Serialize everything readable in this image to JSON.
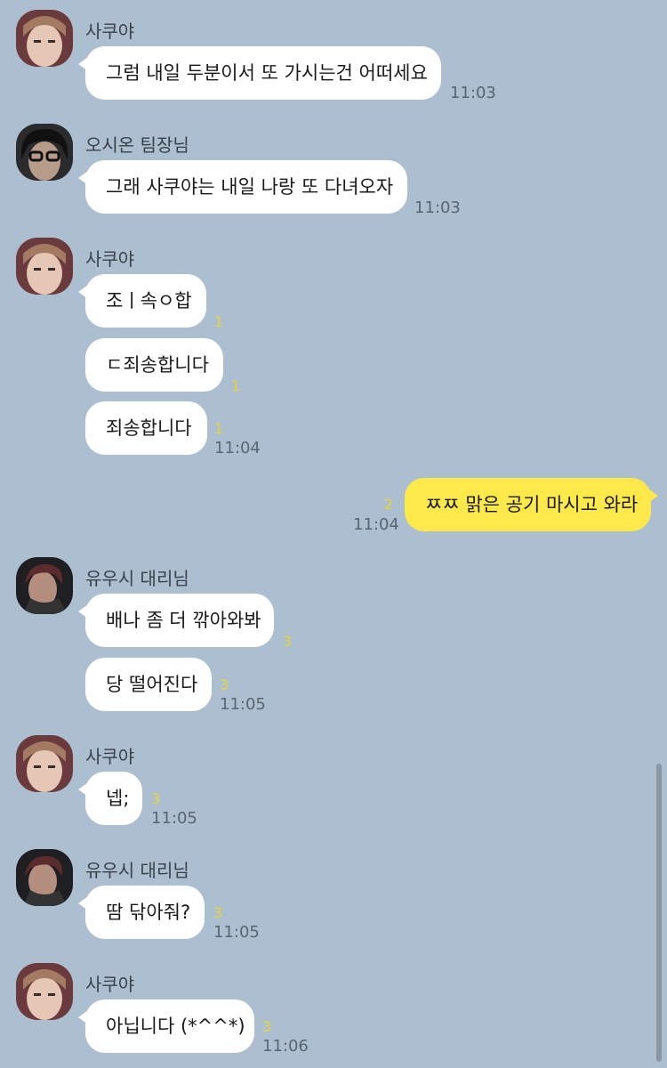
{
  "senders": {
    "sakuya": "사쿠야",
    "team_lead": "오시온 팀장님",
    "yushi": "유우시 대리님"
  },
  "messages": {
    "m1": {
      "text": "그럼 내일 두분이서 또 가시는건 어떠세요",
      "time": "11:03"
    },
    "m2": {
      "text": "그래 사쿠야는 내일 나랑 또 다녀오자",
      "time": "11:03"
    },
    "m3a": {
      "text": "조ㅣ속ㅇ합",
      "unread": "1"
    },
    "m3b": {
      "text": "ㄷ죄송합니다",
      "unread": "1"
    },
    "m3c": {
      "text": "죄송합니다",
      "unread": "1",
      "time": "11:04"
    },
    "m4": {
      "text": "ㅉㅉ 맑은 공기 마시고 와라",
      "unread": "2",
      "time": "11:04"
    },
    "m5a": {
      "text": "배나 좀 더 깎아와봐",
      "unread": "3"
    },
    "m5b": {
      "text": "당 떨어진다",
      "unread": "3",
      "time": "11:05"
    },
    "m6": {
      "text": "넵;",
      "unread": "3",
      "time": "11:05"
    },
    "m7": {
      "text": "땀 닦아줘?",
      "unread": "3",
      "time": "11:05"
    },
    "m8": {
      "text": "아닙니다 (*^^*)",
      "unread": "3",
      "time": "11:06"
    }
  },
  "colors": {
    "background": "#abbfd0",
    "my_bubble": "#fde94a",
    "other_bubble": "#ffffff",
    "unread_count": "#e8d43a"
  }
}
